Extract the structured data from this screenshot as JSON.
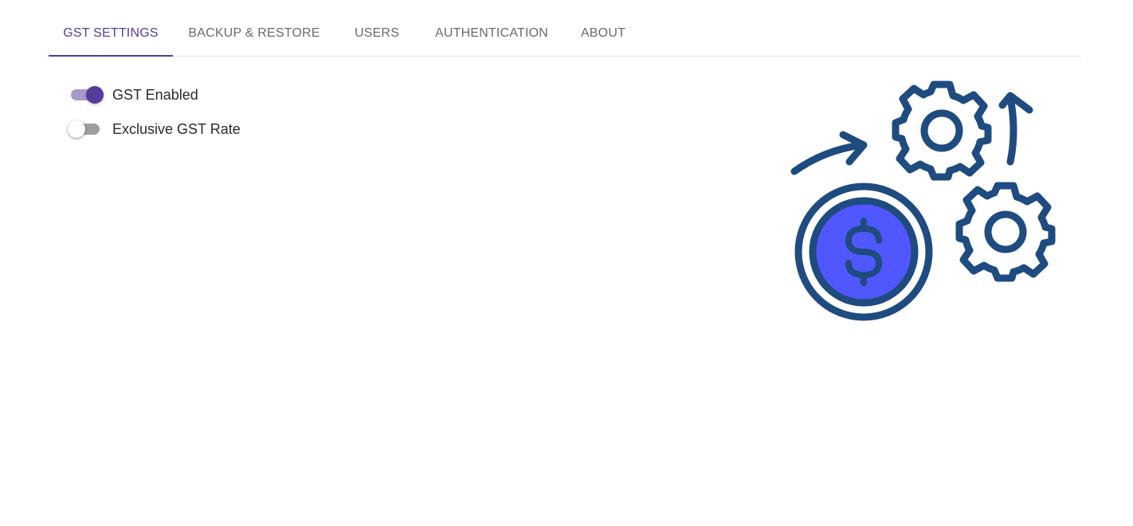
{
  "tabs": [
    {
      "label": "GST SETTINGS",
      "active": true
    },
    {
      "label": "BACKUP & RESTORE",
      "active": false
    },
    {
      "label": "USERS",
      "active": false
    },
    {
      "label": "AUTHENTICATION",
      "active": false
    },
    {
      "label": "ABOUT",
      "active": false
    }
  ],
  "settings": {
    "gst_enabled": {
      "label": "GST Enabled",
      "checked": true
    },
    "exclusive_gst_rate": {
      "label": "Exclusive GST Rate",
      "checked": false
    }
  },
  "illustration": {
    "icons": [
      "dollar-coin-icon",
      "gear-icon",
      "gear-icon",
      "arrow-icon"
    ]
  },
  "colors": {
    "accent": "#553c9a",
    "accent_track": "#a899cc",
    "illustration_stroke": "#1e4b80",
    "coin_fill": "#5157ff"
  }
}
